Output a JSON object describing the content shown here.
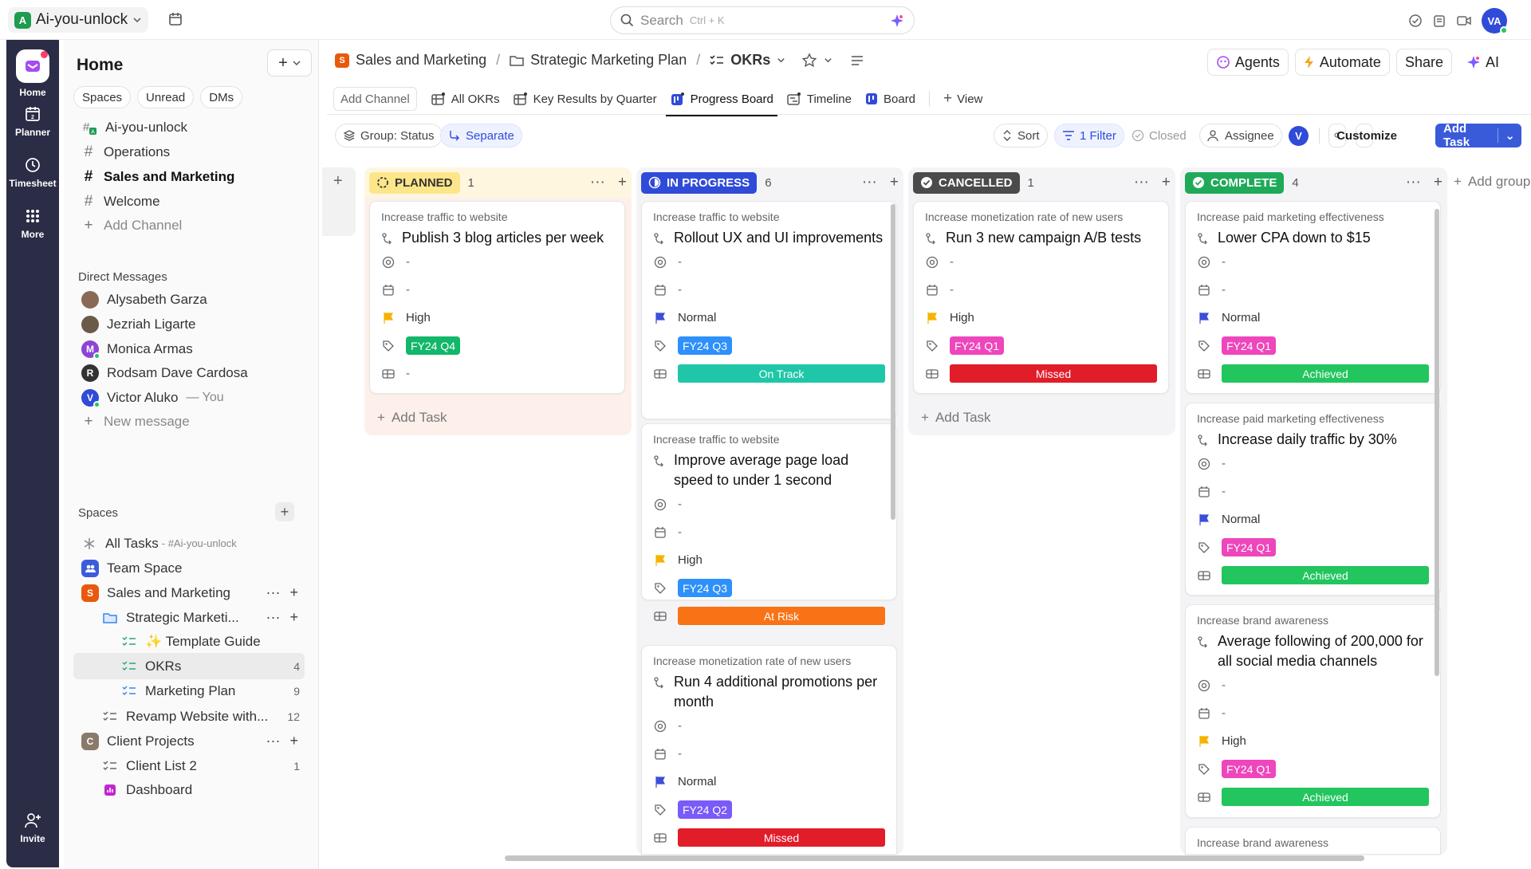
{
  "workspace": {
    "initial": "A",
    "name": "Ai-you-unlock"
  },
  "search": {
    "placeholder": "Search",
    "shortcut": "Ctrl + K"
  },
  "user": {
    "initials": "VA"
  },
  "rail": [
    {
      "label": "Home",
      "icon": "home-icon"
    },
    {
      "label": "Planner",
      "icon": "planner-icon"
    },
    {
      "label": "Timesheet",
      "icon": "clock-icon"
    },
    {
      "label": "More",
      "icon": "grid-icon"
    },
    {
      "label": "Invite",
      "icon": "invite-icon"
    }
  ],
  "sidebar": {
    "title": "Home",
    "pills": [
      "Spaces",
      "Unread",
      "DMs"
    ],
    "channels": [
      {
        "label": "Ai-you-unlock"
      },
      {
        "label": "Operations"
      },
      {
        "label": "Sales and Marketing"
      },
      {
        "label": "Welcome"
      },
      {
        "label": "Add Channel"
      }
    ],
    "dm_header": "Direct Messages",
    "dms": [
      {
        "name": "Alysabeth Garza",
        "suffix": ""
      },
      {
        "name": "Jezriah Ligarte",
        "suffix": ""
      },
      {
        "name": "Monica Armas",
        "suffix": ""
      },
      {
        "name": "Rodsam Dave Cardosa",
        "suffix": ""
      },
      {
        "name": "Victor Aluko",
        "suffix": "— You"
      }
    ],
    "new_message": "New message",
    "spaces_header": "Spaces",
    "spaces": [
      {
        "label": "All Tasks",
        "meta": "- #Ai-you-unlock",
        "count": ""
      },
      {
        "label": "Team Space",
        "meta": "",
        "count": ""
      },
      {
        "label": "Sales and Marketing",
        "meta": "",
        "count": ""
      },
      {
        "label": "Strategic Marketi...",
        "meta": "",
        "count": ""
      },
      {
        "label": "✨ Template Guide",
        "meta": "",
        "count": ""
      },
      {
        "label": "OKRs",
        "meta": "",
        "count": "4"
      },
      {
        "label": "Marketing Plan",
        "meta": "",
        "count": "9"
      },
      {
        "label": "Revamp Website with...",
        "meta": "",
        "count": "12"
      },
      {
        "label": "Client Projects",
        "meta": "",
        "count": ""
      },
      {
        "label": "Client List 2",
        "meta": "",
        "count": "1"
      },
      {
        "label": "Dashboard",
        "meta": "",
        "count": ""
      }
    ]
  },
  "breadcrumb": [
    "Sales and Marketing",
    "Strategic Marketing Plan",
    "OKRs"
  ],
  "header_buttons": [
    "Agents",
    "Automate",
    "Share",
    "AI"
  ],
  "tabs": [
    "Add Channel",
    "All OKRs",
    "Key Results by Quarter",
    "Progress Board",
    "Timeline",
    "Board",
    "View"
  ],
  "filters": {
    "group": "Group: Status",
    "separate": "Separate",
    "sort": "Sort",
    "filter": "1 Filter",
    "closed": "Closed",
    "assignee": "Assignee",
    "me": "V",
    "customize": "Customize",
    "add_task": "Add Task"
  },
  "board": {
    "add_task": "Add Task",
    "add_group": "Add group",
    "columns": [
      {
        "status": "PLANNED",
        "count": "1",
        "color": "#fbbf24",
        "cards": [
          {
            "context": "Increase traffic to website",
            "title": "Publish 3 blog articles per week",
            "assignee": "-",
            "date": "-",
            "priority": "High",
            "tag": "FY24 Q4",
            "result": "-"
          }
        ]
      },
      {
        "status": "IN PROGRESS",
        "count": "6",
        "color": "#2f4bd8",
        "cards": [
          {
            "context": "Increase traffic to website",
            "title": "Rollout UX and UI improvements",
            "assignee": "-",
            "date": "-",
            "priority": "Normal",
            "tag": "FY24 Q3",
            "result": "On Track"
          },
          {
            "context": "Increase traffic to website",
            "title": "Improve average page load speed to under 1 second",
            "assignee": "-",
            "date": "-",
            "priority": "High",
            "tag": "FY24 Q3",
            "result": "At Risk"
          },
          {
            "context": "Increase monetization rate of new users",
            "title": "Run 4 additional promotions per month",
            "assignee": "-",
            "date": "-",
            "priority": "Normal",
            "tag": "FY24 Q2",
            "result": "Missed"
          }
        ]
      },
      {
        "status": "CANCELLED",
        "count": "1",
        "color": "#4b4b4b",
        "cards": [
          {
            "context": "Increase monetization rate of new users",
            "title": "Run 3 new campaign A/B tests",
            "assignee": "-",
            "date": "-",
            "priority": "High",
            "tag": "FY24 Q1",
            "result": "Missed"
          }
        ]
      },
      {
        "status": "COMPLETE",
        "count": "4",
        "color": "#1faa59",
        "cards": [
          {
            "context": "Increase paid marketing effectiveness",
            "title": "Lower CPA down to $15",
            "assignee": "-",
            "date": "-",
            "priority": "Normal",
            "tag": "FY24 Q1",
            "result": "Achieved"
          },
          {
            "context": "Increase paid marketing effectiveness",
            "title": "Increase daily traffic by 30%",
            "assignee": "-",
            "date": "-",
            "priority": "Normal",
            "tag": "FY24 Q1",
            "result": "Achieved"
          },
          {
            "context": "Increase brand awareness",
            "title": "Average following of 200,000 for all social media channels",
            "assignee": "-",
            "date": "-",
            "priority": "High",
            "tag": "FY24 Q1",
            "result": "Achieved"
          },
          {
            "context": "Increase brand awareness",
            "title": "",
            "assignee": "",
            "date": "",
            "priority": "",
            "tag": "",
            "result": ""
          }
        ]
      }
    ]
  },
  "colors": {
    "tag_q4": "#12b76a",
    "tag_q3": "#2e90fa",
    "tag_q2": "#7a5af8",
    "tag_q1": "#ee46bc",
    "on_track": "#1fc7a8",
    "at_risk": "#f97316",
    "missed": "#e11d2a",
    "achieved": "#22c55e",
    "priority_high": "#f5b301",
    "priority_normal": "#3b4fd8"
  }
}
